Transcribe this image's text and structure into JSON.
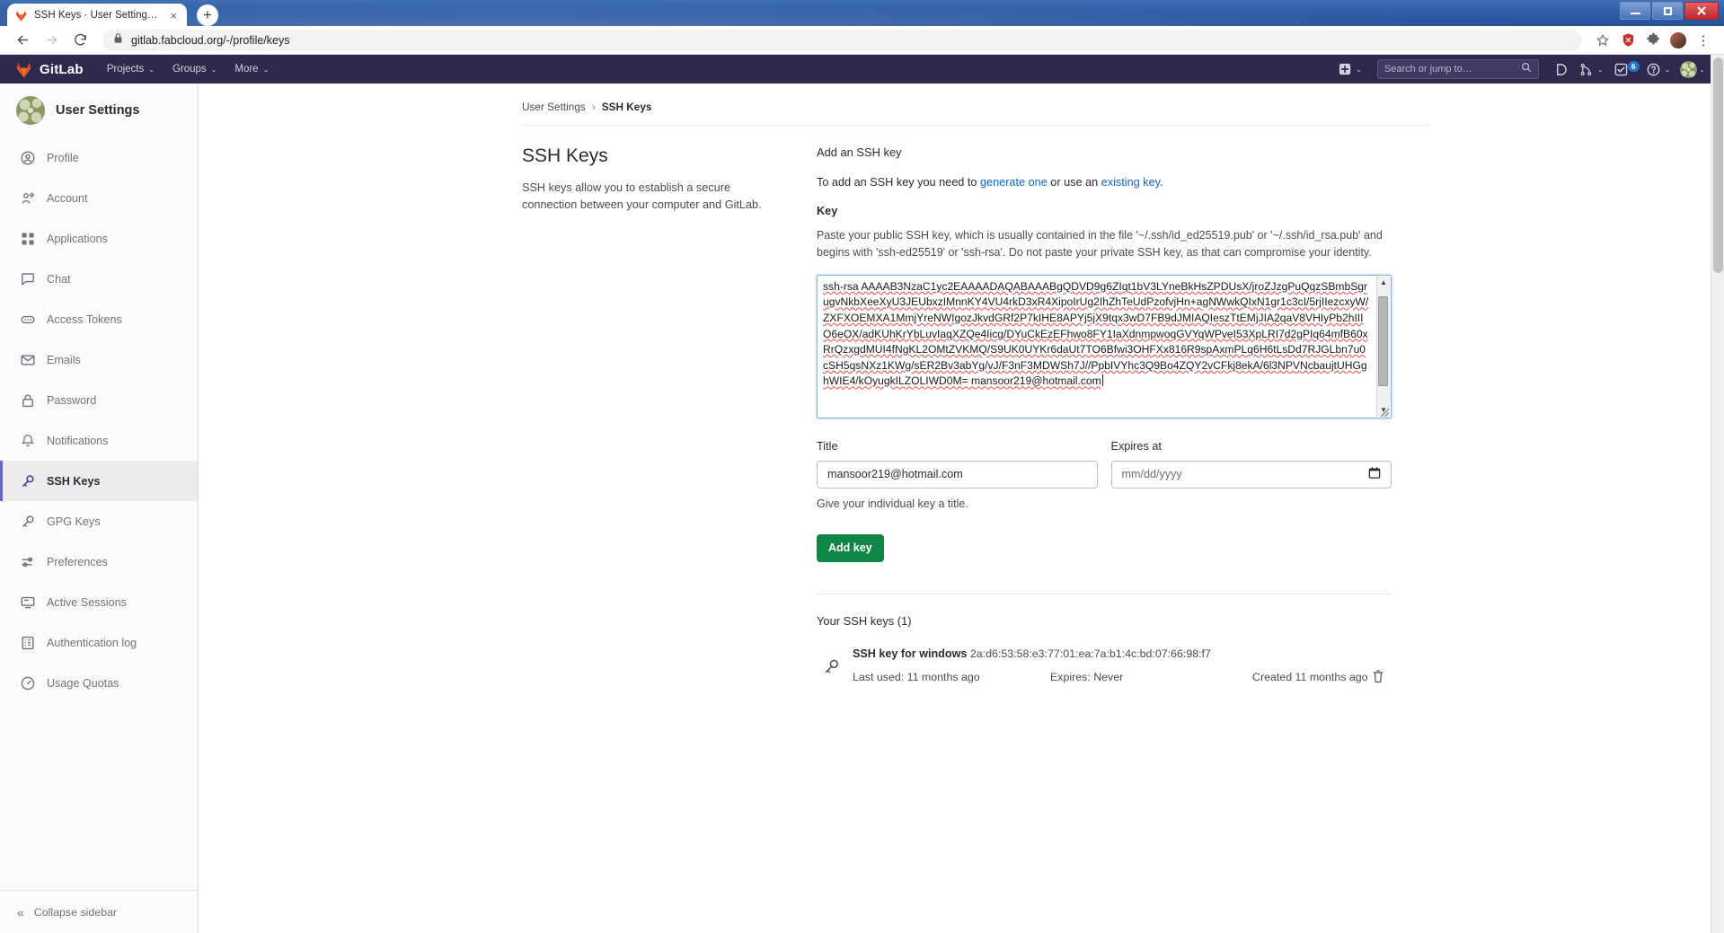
{
  "window": {
    "minimize_label": "Minimize",
    "restore_label": "Restore",
    "close_label": "Close"
  },
  "browser": {
    "tab_title": "SSH Keys · User Settings · GitLab",
    "tab_close_label": "×",
    "new_tab_label": "+",
    "back_label": "←",
    "forward_label": "→",
    "reload_label": "⟳",
    "url": "gitlab.fabcloud.org/-/profile/keys",
    "lock_label": "🔒",
    "star_label": "☆",
    "menu_label": "⋮"
  },
  "gitlab_nav": {
    "wordmark": "GitLab",
    "items": [
      {
        "label": "Projects",
        "caret": "⌄"
      },
      {
        "label": "Groups",
        "caret": "⌄"
      },
      {
        "label": "More",
        "caret": "⌄"
      }
    ],
    "create_caret": "⌄",
    "search_placeholder": "Search or jump to…",
    "todos_count": "6",
    "merge_caret": "⌄",
    "help_caret": "⌄",
    "avatar_caret": "⌄"
  },
  "sidebar": {
    "header": "User Settings",
    "items": [
      {
        "label": "Profile",
        "icon": "user-circle-icon",
        "active": false
      },
      {
        "label": "Account",
        "icon": "account-gear-icon",
        "active": false
      },
      {
        "label": "Applications",
        "icon": "applications-grid-icon",
        "active": false
      },
      {
        "label": "Chat",
        "icon": "chat-bubble-icon",
        "active": false
      },
      {
        "label": "Access Tokens",
        "icon": "token-icon",
        "active": false
      },
      {
        "label": "Emails",
        "icon": "envelope-icon",
        "active": false
      },
      {
        "label": "Password",
        "icon": "lock-icon",
        "active": false
      },
      {
        "label": "Notifications",
        "icon": "bell-icon",
        "active": false
      },
      {
        "label": "SSH Keys",
        "icon": "key-icon",
        "active": true
      },
      {
        "label": "GPG Keys",
        "icon": "key-icon",
        "active": false
      },
      {
        "label": "Preferences",
        "icon": "sliders-icon",
        "active": false
      },
      {
        "label": "Active Sessions",
        "icon": "monitor-icon",
        "active": false
      },
      {
        "label": "Authentication log",
        "icon": "log-list-icon",
        "active": false
      },
      {
        "label": "Usage Quotas",
        "icon": "gauge-icon",
        "active": false
      }
    ],
    "collapse_label": "Collapse sidebar",
    "collapse_icon": "«"
  },
  "breadcrumb": {
    "parent": "User Settings",
    "separator": "›",
    "current": "SSH Keys"
  },
  "left_panel": {
    "title": "SSH Keys",
    "description": "SSH keys allow you to establish a secure connection between your computer and GitLab."
  },
  "form": {
    "heading": "Add an SSH key",
    "intro_prefix": "To add an SSH key you need to ",
    "intro_link1": "generate one",
    "intro_middle": " or use an ",
    "intro_link2": "existing key",
    "intro_suffix": ".",
    "key_label": "Key",
    "key_help": "Paste your public SSH key, which is usually contained in the file '~/.ssh/id_ed25519.pub' or '~/.ssh/id_rsa.pub' and begins with 'ssh-ed25519' or 'ssh-rsa'. Do not paste your private SSH key, as that can compromise your identity.",
    "key_value": "ssh-rsa AAAAB3NzaC1yc2EAAAADAQABAAABgQDVD9g6ZIqt1bV3LYneBkHsZPDUsX/jroZJzgPuQqzSBmbSgrugvNkbXeeXyU3JEUbxzIMnnKY4VU4rkD3xR4XipoIrUg2IhZhTeUdPzofvjHn+agNWwkQIxN1gr1c3cI/5rjIIezcxyW/ZXFXOEMXA1MmjYreNWIgozJkvdGRf2P7kIHE8APYj5jX9tqx3wD7FB9dJMIAQIeszTtEMjJIA2qaV8VHIyPb2hIIIO6eOX/adKUhKrYbLuvIaqXZQe4Iicg/DYuCkEzEFhwo8FY1IaXdnmpwoqGVYqWPveI53XpLRI7d2gPIq64mfB60xRrQzxgdMUI4fNgKL2OMtZVKMQ/S9UK0UYKr6daUt7TO6Bfwi3OHFXx816R9spAxmPLq6H6tLsDd7RJGLbn7u0cSH5qsNXz1KWg/sER2Bv3abYg/vJ/F3nF3MDWSh7J//PpbIVYhc3Q9Bo4ZQY2vCFkj8ekA/6l3NPVNcbaujtUHGghWIE4/kOyugkILZOLIWD0M= mansoor219@hotmail.com",
    "title_label": "Title",
    "title_value": "mansoor219@hotmail.com",
    "expires_label": "Expires at",
    "expires_placeholder": "mm/dd/yyyy",
    "expires_icon": "calendar-icon",
    "title_hint": "Give your individual key a title.",
    "submit_label": "Add key",
    "submit_color": "#108548"
  },
  "keys_list": {
    "heading": "Your SSH keys (1)",
    "rows": [
      {
        "name": "SSH key for windows",
        "fingerprint": "2a:d6:53:58:e3:77:01:ea:7a:b1:4c:bd:07:66:98:f7",
        "last_used": "Last used: 11 months ago",
        "expires": "Expires: Never",
        "created": "Created 11 months ago",
        "delete_icon": "trash-icon"
      }
    ]
  },
  "colors": {
    "gitlab_navy": "#2e2a4d",
    "accent_purple": "#6666c4",
    "link_blue": "#1068bf",
    "green": "#108548",
    "badge_blue": "#1f75cb"
  }
}
